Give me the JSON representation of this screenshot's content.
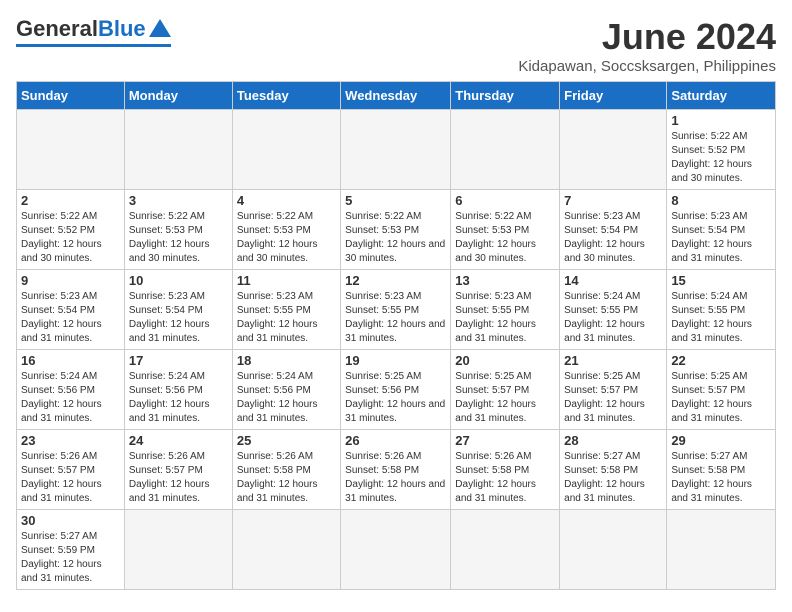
{
  "header": {
    "logo_general": "General",
    "logo_blue": "Blue",
    "month_year": "June 2024",
    "location": "Kidapawan, Soccsksargen, Philippines"
  },
  "weekdays": [
    "Sunday",
    "Monday",
    "Tuesday",
    "Wednesday",
    "Thursday",
    "Friday",
    "Saturday"
  ],
  "weeks": [
    [
      {
        "day": "",
        "empty": true
      },
      {
        "day": "",
        "empty": true
      },
      {
        "day": "",
        "empty": true
      },
      {
        "day": "",
        "empty": true
      },
      {
        "day": "",
        "empty": true
      },
      {
        "day": "",
        "empty": true
      },
      {
        "day": "1",
        "sunrise": "5:22 AM",
        "sunset": "5:52 PM",
        "daylight": "12 hours and 30 minutes."
      }
    ],
    [
      {
        "day": "2",
        "sunrise": "5:22 AM",
        "sunset": "5:52 PM",
        "daylight": "12 hours and 30 minutes."
      },
      {
        "day": "3",
        "sunrise": "5:22 AM",
        "sunset": "5:53 PM",
        "daylight": "12 hours and 30 minutes."
      },
      {
        "day": "4",
        "sunrise": "5:22 AM",
        "sunset": "5:53 PM",
        "daylight": "12 hours and 30 minutes."
      },
      {
        "day": "5",
        "sunrise": "5:22 AM",
        "sunset": "5:53 PM",
        "daylight": "12 hours and 30 minutes."
      },
      {
        "day": "6",
        "sunrise": "5:22 AM",
        "sunset": "5:53 PM",
        "daylight": "12 hours and 30 minutes."
      },
      {
        "day": "7",
        "sunrise": "5:23 AM",
        "sunset": "5:54 PM",
        "daylight": "12 hours and 30 minutes."
      },
      {
        "day": "8",
        "sunrise": "5:23 AM",
        "sunset": "5:54 PM",
        "daylight": "12 hours and 31 minutes."
      }
    ],
    [
      {
        "day": "9",
        "sunrise": "5:23 AM",
        "sunset": "5:54 PM",
        "daylight": "12 hours and 31 minutes."
      },
      {
        "day": "10",
        "sunrise": "5:23 AM",
        "sunset": "5:54 PM",
        "daylight": "12 hours and 31 minutes."
      },
      {
        "day": "11",
        "sunrise": "5:23 AM",
        "sunset": "5:55 PM",
        "daylight": "12 hours and 31 minutes."
      },
      {
        "day": "12",
        "sunrise": "5:23 AM",
        "sunset": "5:55 PM",
        "daylight": "12 hours and 31 minutes."
      },
      {
        "day": "13",
        "sunrise": "5:23 AM",
        "sunset": "5:55 PM",
        "daylight": "12 hours and 31 minutes."
      },
      {
        "day": "14",
        "sunrise": "5:24 AM",
        "sunset": "5:55 PM",
        "daylight": "12 hours and 31 minutes."
      },
      {
        "day": "15",
        "sunrise": "5:24 AM",
        "sunset": "5:55 PM",
        "daylight": "12 hours and 31 minutes."
      }
    ],
    [
      {
        "day": "16",
        "sunrise": "5:24 AM",
        "sunset": "5:56 PM",
        "daylight": "12 hours and 31 minutes."
      },
      {
        "day": "17",
        "sunrise": "5:24 AM",
        "sunset": "5:56 PM",
        "daylight": "12 hours and 31 minutes."
      },
      {
        "day": "18",
        "sunrise": "5:24 AM",
        "sunset": "5:56 PM",
        "daylight": "12 hours and 31 minutes."
      },
      {
        "day": "19",
        "sunrise": "5:25 AM",
        "sunset": "5:56 PM",
        "daylight": "12 hours and 31 minutes."
      },
      {
        "day": "20",
        "sunrise": "5:25 AM",
        "sunset": "5:57 PM",
        "daylight": "12 hours and 31 minutes."
      },
      {
        "day": "21",
        "sunrise": "5:25 AM",
        "sunset": "5:57 PM",
        "daylight": "12 hours and 31 minutes."
      },
      {
        "day": "22",
        "sunrise": "5:25 AM",
        "sunset": "5:57 PM",
        "daylight": "12 hours and 31 minutes."
      }
    ],
    [
      {
        "day": "23",
        "sunrise": "5:26 AM",
        "sunset": "5:57 PM",
        "daylight": "12 hours and 31 minutes."
      },
      {
        "day": "24",
        "sunrise": "5:26 AM",
        "sunset": "5:57 PM",
        "daylight": "12 hours and 31 minutes."
      },
      {
        "day": "25",
        "sunrise": "5:26 AM",
        "sunset": "5:58 PM",
        "daylight": "12 hours and 31 minutes."
      },
      {
        "day": "26",
        "sunrise": "5:26 AM",
        "sunset": "5:58 PM",
        "daylight": "12 hours and 31 minutes."
      },
      {
        "day": "27",
        "sunrise": "5:26 AM",
        "sunset": "5:58 PM",
        "daylight": "12 hours and 31 minutes."
      },
      {
        "day": "28",
        "sunrise": "5:27 AM",
        "sunset": "5:58 PM",
        "daylight": "12 hours and 31 minutes."
      },
      {
        "day": "29",
        "sunrise": "5:27 AM",
        "sunset": "5:58 PM",
        "daylight": "12 hours and 31 minutes."
      }
    ],
    [
      {
        "day": "30",
        "sunrise": "5:27 AM",
        "sunset": "5:59 PM",
        "daylight": "12 hours and 31 minutes."
      },
      {
        "day": "",
        "empty": true
      },
      {
        "day": "",
        "empty": true
      },
      {
        "day": "",
        "empty": true
      },
      {
        "day": "",
        "empty": true
      },
      {
        "day": "",
        "empty": true
      },
      {
        "day": "",
        "empty": true
      }
    ]
  ]
}
